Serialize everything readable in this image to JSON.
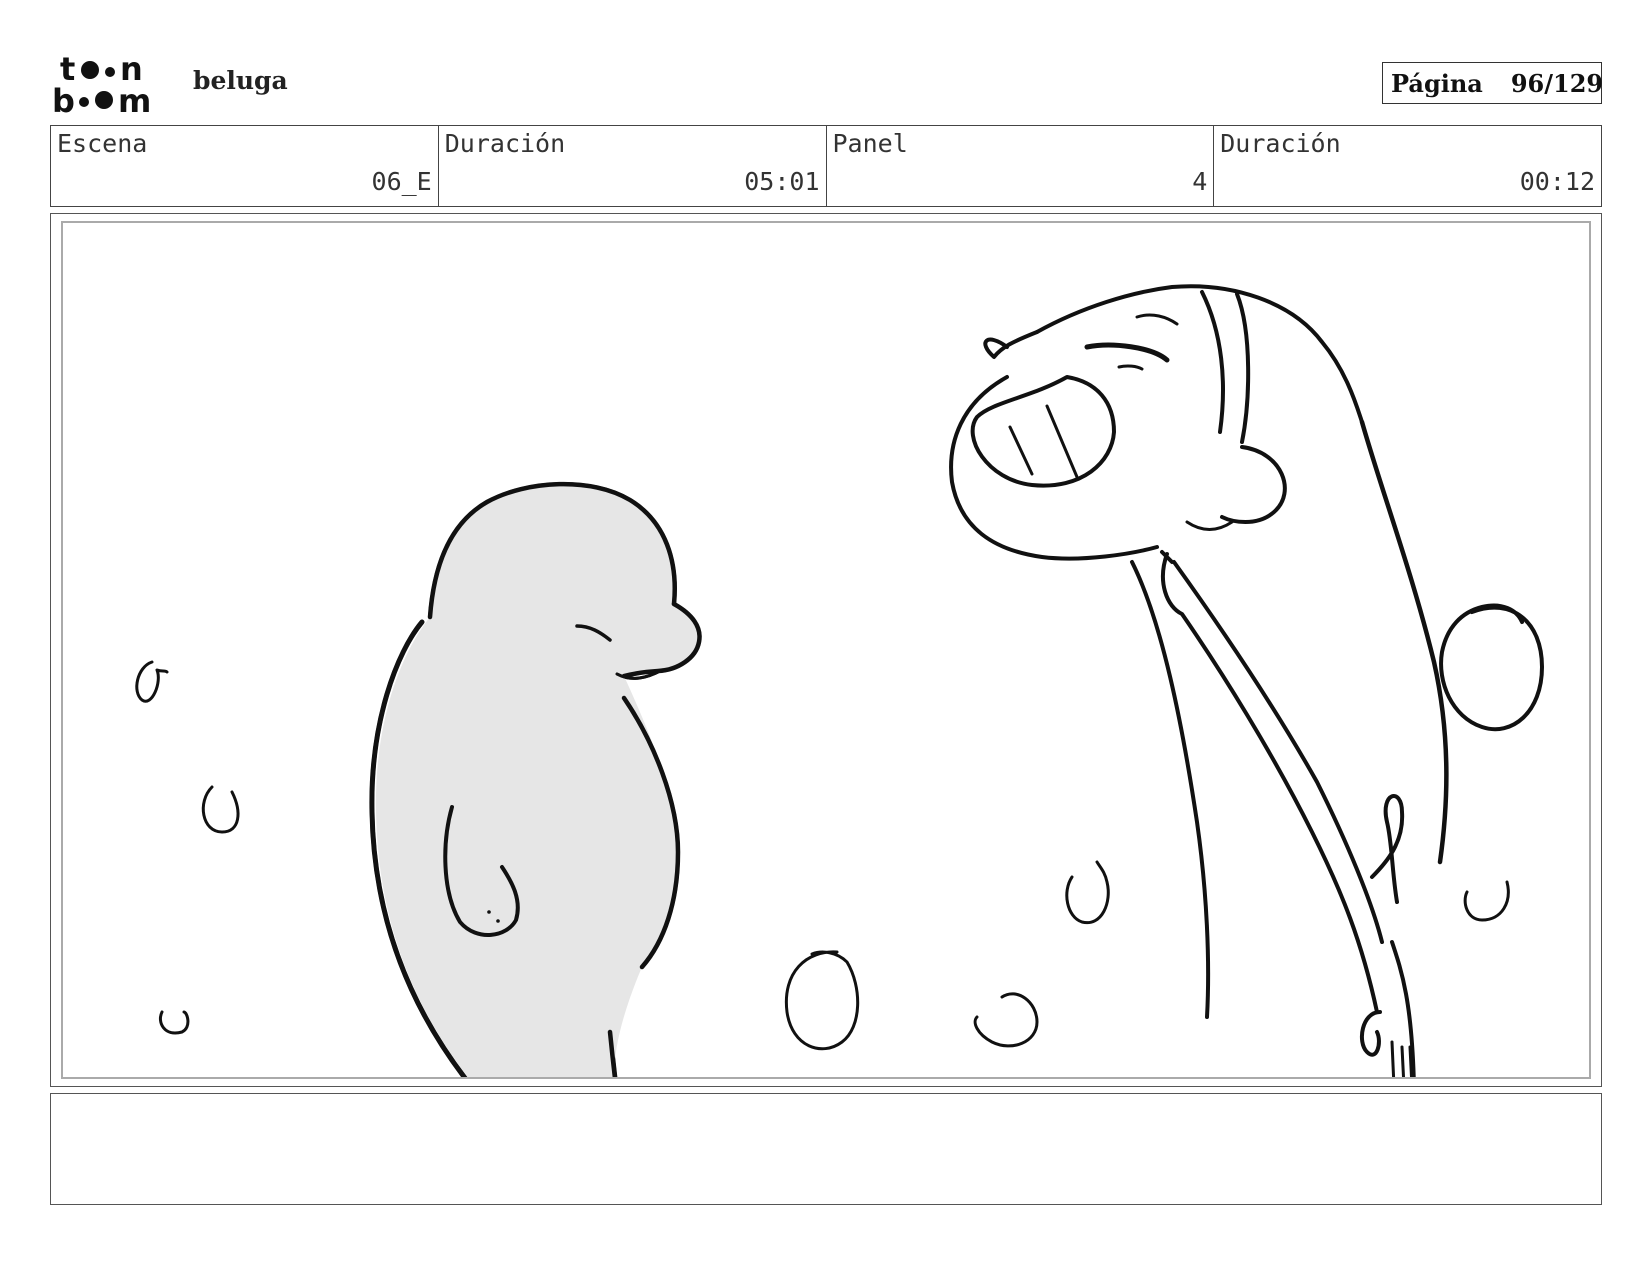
{
  "header": {
    "logo": {
      "line1": "toon",
      "line2": "boom"
    },
    "project_name": "beluga",
    "page_label": "Página",
    "page_number": "96/129"
  },
  "info": {
    "scene_label": "Escena",
    "scene_value": "06_E",
    "scene_duration_label": "Duración",
    "scene_duration_value": "05:01",
    "panel_label": "Panel",
    "panel_value": "4",
    "panel_duration_label": "Duración",
    "panel_duration_value": "00:12"
  },
  "drawing": {
    "beluga_fill": "#e6e6e6",
    "ink": "#111111"
  },
  "notes": {
    "text": ""
  }
}
